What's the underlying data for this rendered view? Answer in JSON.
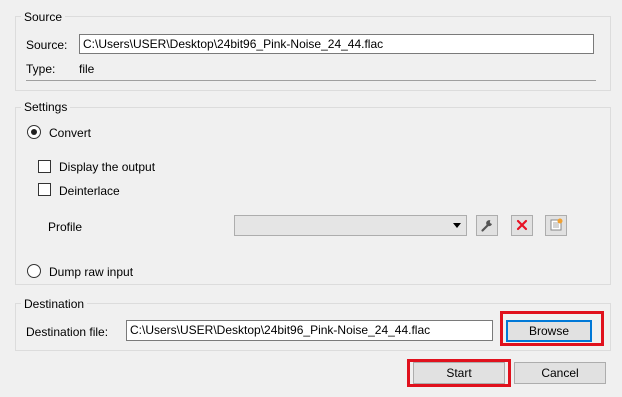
{
  "source": {
    "group_title": "Source",
    "source_label": "Source:",
    "source_value": "C:\\Users\\USER\\Desktop\\24bit96_Pink-Noise_24_44.flac",
    "type_label": "Type:",
    "type_value": "file"
  },
  "settings": {
    "group_title": "Settings",
    "convert_label": "Convert",
    "convert_checked": true,
    "display_output_label": "Display the output",
    "deinterlace_label": "Deinterlace",
    "profile_label": "Profile",
    "profile_value": "",
    "dump_raw_label": "Dump raw input"
  },
  "destination": {
    "group_title": "Destination",
    "file_label": "Destination file:",
    "file_value": "C:\\Users\\USER\\Desktop\\24bit96_Pink-Noise_24_44.flac",
    "browse_label": "Browse"
  },
  "footer": {
    "start_label": "Start",
    "cancel_label": "Cancel"
  },
  "colors": {
    "highlight": "#e0111d",
    "delete_icon": "#e81123",
    "focus": "#0078d7"
  }
}
